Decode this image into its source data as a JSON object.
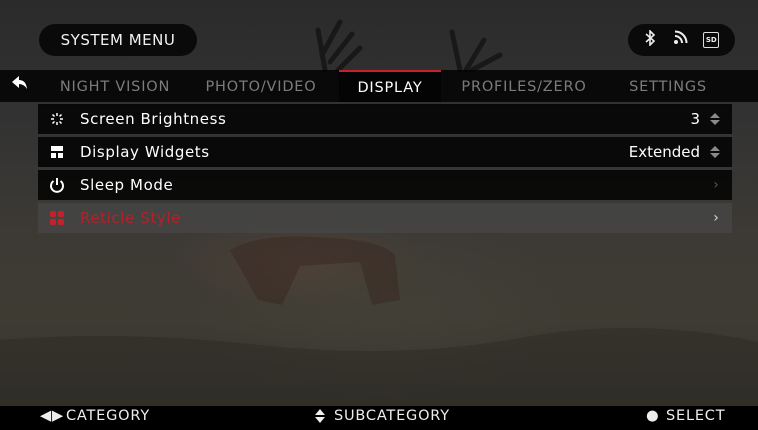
{
  "header": {
    "title": "SYSTEM MENU",
    "status_icons": [
      "bluetooth-icon",
      "wifi-icon",
      "sd-card-icon"
    ],
    "sd_label": "SD"
  },
  "tabs": {
    "back_icon": "back-arrow-icon",
    "items": [
      {
        "label": "NIGHT VISION",
        "active": false
      },
      {
        "label": "PHOTO/VIDEO",
        "active": false
      },
      {
        "label": "DISPLAY",
        "active": true
      },
      {
        "label": "PROFILES/ZERO",
        "active": false
      },
      {
        "label": "SETTINGS",
        "active": false
      }
    ]
  },
  "menu": {
    "items": [
      {
        "icon": "brightness-icon",
        "label": "Screen Brightness",
        "value": "3",
        "control": "up-down"
      },
      {
        "icon": "widgets-icon",
        "label": "Display Widgets",
        "value": "Extended",
        "control": "up-down"
      },
      {
        "icon": "power-icon",
        "label": "Sleep Mode",
        "value": "",
        "control": "chevron"
      },
      {
        "icon": "reticle-icon",
        "label": "Reticle Style",
        "value": "",
        "control": "chevron",
        "selected": true
      }
    ]
  },
  "footer": {
    "category": "CATEGORY",
    "subcategory": "SUBCATEGORY",
    "select": "SELECT"
  },
  "colors": {
    "accent": "#c8202a",
    "selected_text": "#b2222b",
    "inactive_tab": "#7c7c7c"
  }
}
